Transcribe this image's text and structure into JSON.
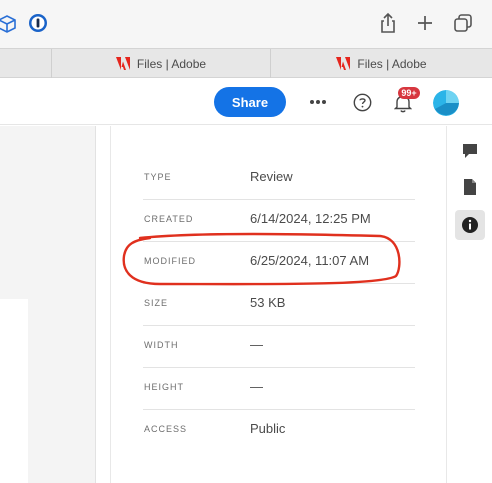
{
  "browser": {
    "tabs": [
      {
        "label": "Files | Adobe"
      },
      {
        "label": "Files | Adobe"
      }
    ]
  },
  "header": {
    "share_label": "Share",
    "notification_count": "99+"
  },
  "info": {
    "rows": [
      {
        "label": "TYPE",
        "value": "Review"
      },
      {
        "label": "CREATED",
        "value": "6/14/2024, 12:25 PM"
      },
      {
        "label": "MODIFIED",
        "value": "6/25/2024, 11:07 AM"
      },
      {
        "label": "SIZE",
        "value": "53 KB"
      },
      {
        "label": "WIDTH",
        "value": "—"
      },
      {
        "label": "HEIGHT",
        "value": "—"
      },
      {
        "label": "ACCESS",
        "value": "Public"
      }
    ]
  },
  "rail": {
    "items": [
      {
        "icon": "comment-icon"
      },
      {
        "icon": "document-icon"
      },
      {
        "icon": "info-icon",
        "active": true
      }
    ]
  },
  "colors": {
    "accent": "#1473e6",
    "badge": "#d7373f",
    "annotation": "#e0301e",
    "adobe_red": "#e5261e"
  }
}
